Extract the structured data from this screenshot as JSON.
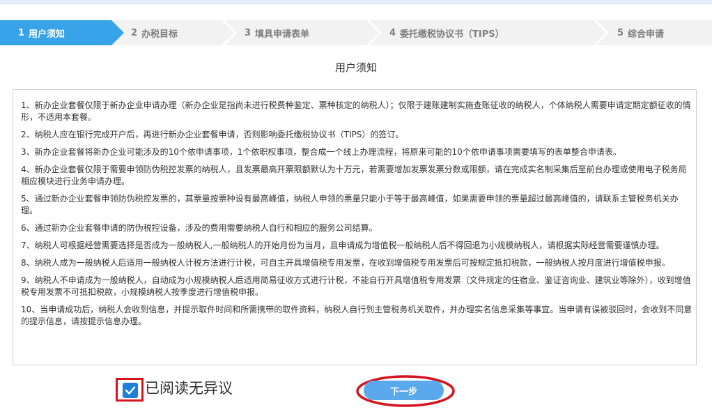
{
  "steps": [
    {
      "num": "1",
      "label": "用户须知",
      "active": true
    },
    {
      "num": "2",
      "label": "办税目标",
      "active": false
    },
    {
      "num": "3",
      "label": "填具申请表单",
      "active": false
    },
    {
      "num": "4",
      "label": "委托缴税协议书（TIPS）",
      "active": false
    },
    {
      "num": "5",
      "label": "综合申请",
      "active": false
    }
  ],
  "title": "用户须知",
  "items": [
    "1、新办企业套餐仅限于新办企业申请办理（新办企业是指尚未进行税费种鉴定、票种核定的纳税人）；仅限于建账建制实施查账征收的纳税人，个体纳税人需要申请定期定额征收的情形，不适用本套餐。",
    "2、纳税人应在银行完成开户后，再进行新办企业套餐申请，否则影响委托缴税协议书（TIPS）的签订。",
    "3、新办企业套餐将新办企业可能涉及的10个依申请事项，1个依职权事项，整合成一个线上办理流程，将原来可能的10个依申请事项需要填写的表单整合申请表。",
    "4、新办企业套餐仅限于需要申领防伪税控发票的纳税人，且发票最高开票限额默认为十万元，若需要增加发票发票分数或限额，请在完成实名制采集后至前台办理或使用电子税务局相应模块进行业务申请办理。",
    "5、通过新办企业套餐申领防伪税控发票的，其票量按票种设有最高峰值，纳税人申领的票量只能小于等于最高峰值，如果需要申领的票量超过最高峰值的，请联系主管税务机关办理。",
    "6、通过新办企业套餐申请的防伪税控设备，涉及的费用需要纳税人自行和相应的服务公司结算。",
    "7、纳税人可根据经营需要选择是否成为一般纳税人,一般纳税人的开始月份为当月，且申请成为增值税一般纳税人后不得回退为小规模纳税人，请根据实际经营需要谨慎办理。",
    "8、纳税人成为一般纳税人后适用一般纳税人计税方法进行计税，可自主开具增值税专用发票，在收到增值税专用发票后可按规定抵扣税款，一般纳税人按月度进行增值税申报。",
    "9、纳税人不申请成为一般纳税人，自动成为小规模纳税人后适用简易征收方式进行计税，不能自行开具增值税专用发票（文件规定的住宿业、鉴证咨询业、建筑业等除外），收到增值税专用发票不可抵扣税款，小规模纳税人按季度进行增值税申报。",
    "10、当申请成功后，纳税人会收到信息，并提示取件时间和所需携带的取件资料，纳税人自行到主管税务机关取件，并办理实名信息采集等事宜。当申请有误被驳回时，会收到不同意的提示信息，请按提示信息办理。"
  ],
  "agree_label": "已阅读无异议",
  "agree_checked": true,
  "next_label": "下一步",
  "colors": {
    "accent": "#38a3e8",
    "highlight": "#d4141e",
    "button": "#5aa9ec"
  }
}
